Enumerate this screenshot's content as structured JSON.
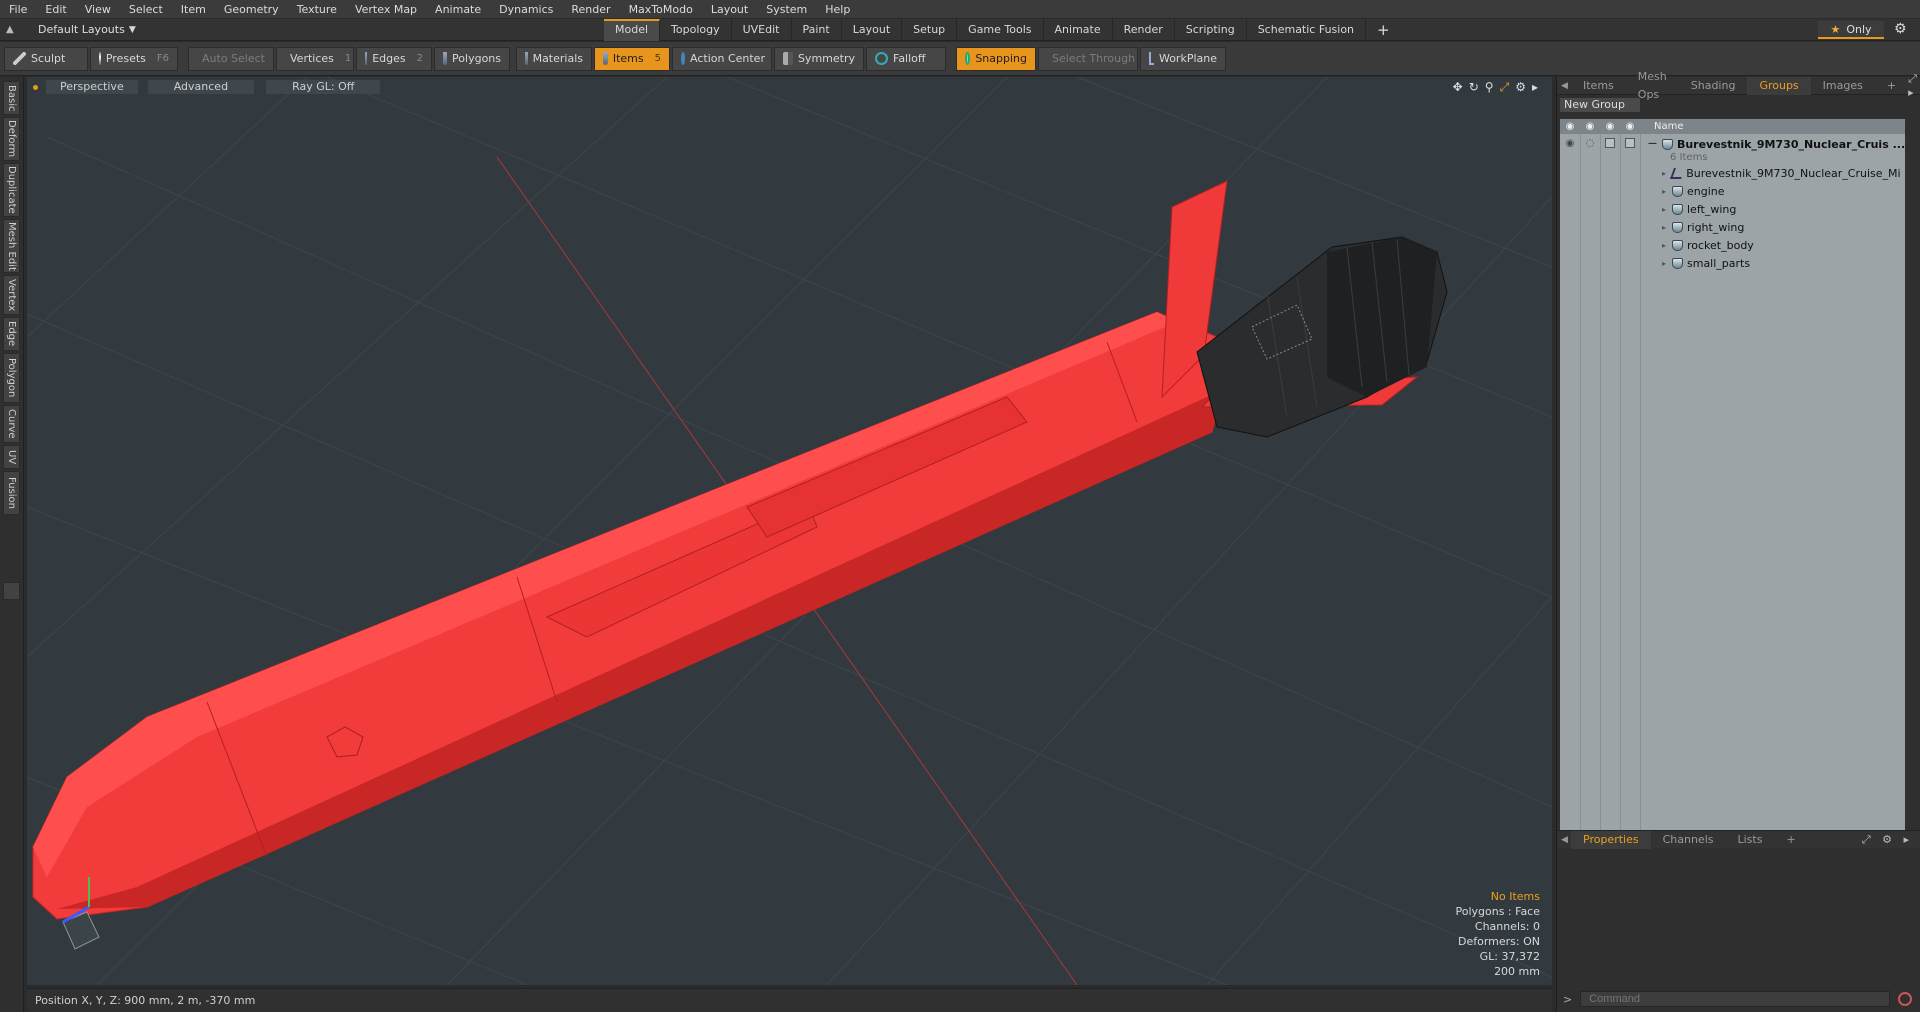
{
  "menu": [
    "File",
    "Edit",
    "View",
    "Select",
    "Item",
    "Geometry",
    "Texture",
    "Vertex Map",
    "Animate",
    "Dynamics",
    "Render",
    "MaxToModo",
    "Layout",
    "System",
    "Help"
  ],
  "layout": {
    "label": "Default Layouts"
  },
  "mode_tabs": [
    "Model",
    "Topology",
    "UVEdit",
    "Paint",
    "Layout",
    "Setup",
    "Game Tools",
    "Animate",
    "Render",
    "Scripting",
    "Schematic Fusion"
  ],
  "mode_active": "Model",
  "only_label": "Only",
  "toolbar": {
    "sculpt": "Sculpt",
    "presets": "Presets",
    "presets_key": "F6",
    "auto_select": "Auto Select",
    "vertices": "Vertices",
    "vertices_key": "1",
    "edges": "Edges",
    "edges_key": "2",
    "polygons": "Polygons",
    "materials": "Materials",
    "items": "Items",
    "items_key": "5",
    "action_center": "Action Center",
    "symmetry": "Symmetry",
    "falloff": "Falloff",
    "snapping": "Snapping",
    "select_through": "Select Through",
    "workplane": "WorkPlane"
  },
  "left_tabs": [
    "Basic",
    "Deform",
    "Duplicate",
    "Mesh Edit",
    "Vertex",
    "Edge",
    "Polygon",
    "Curve",
    "UV",
    "Fusion"
  ],
  "viewport": {
    "view": "Perspective",
    "shading": "Advanced",
    "raygl": "Ray GL: Off",
    "stats": [
      "No Items",
      "Polygons : Face",
      "Channels: 0",
      "Deformers: ON",
      "GL: 37,372",
      "200 mm"
    ]
  },
  "status": {
    "position": "Position X, Y, Z:   900 mm, 2 m, -370 mm"
  },
  "right_panel": {
    "tabs": [
      "Items",
      "Mesh Ops",
      "Shading",
      "Groups",
      "Images"
    ],
    "active_tab": "Groups",
    "new_group": "New Group",
    "name_col": "Name",
    "root": "Burevestnik_9M730_Nuclear_Cruis ...",
    "root_count": "6 Items",
    "children": [
      "Burevestnik_9M730_Nuclear_Cruise_Mi ...",
      "engine",
      "left_wing",
      "right_wing",
      "rocket_body",
      "small_parts"
    ],
    "bottom_tabs": [
      "Properties",
      "Channels",
      "Lists"
    ],
    "bottom_active": "Properties",
    "command_placeholder": "Command"
  },
  "colors": {
    "accent": "#e8951e",
    "missile": "#f23b3b",
    "viewport_bg": "#323a40"
  }
}
